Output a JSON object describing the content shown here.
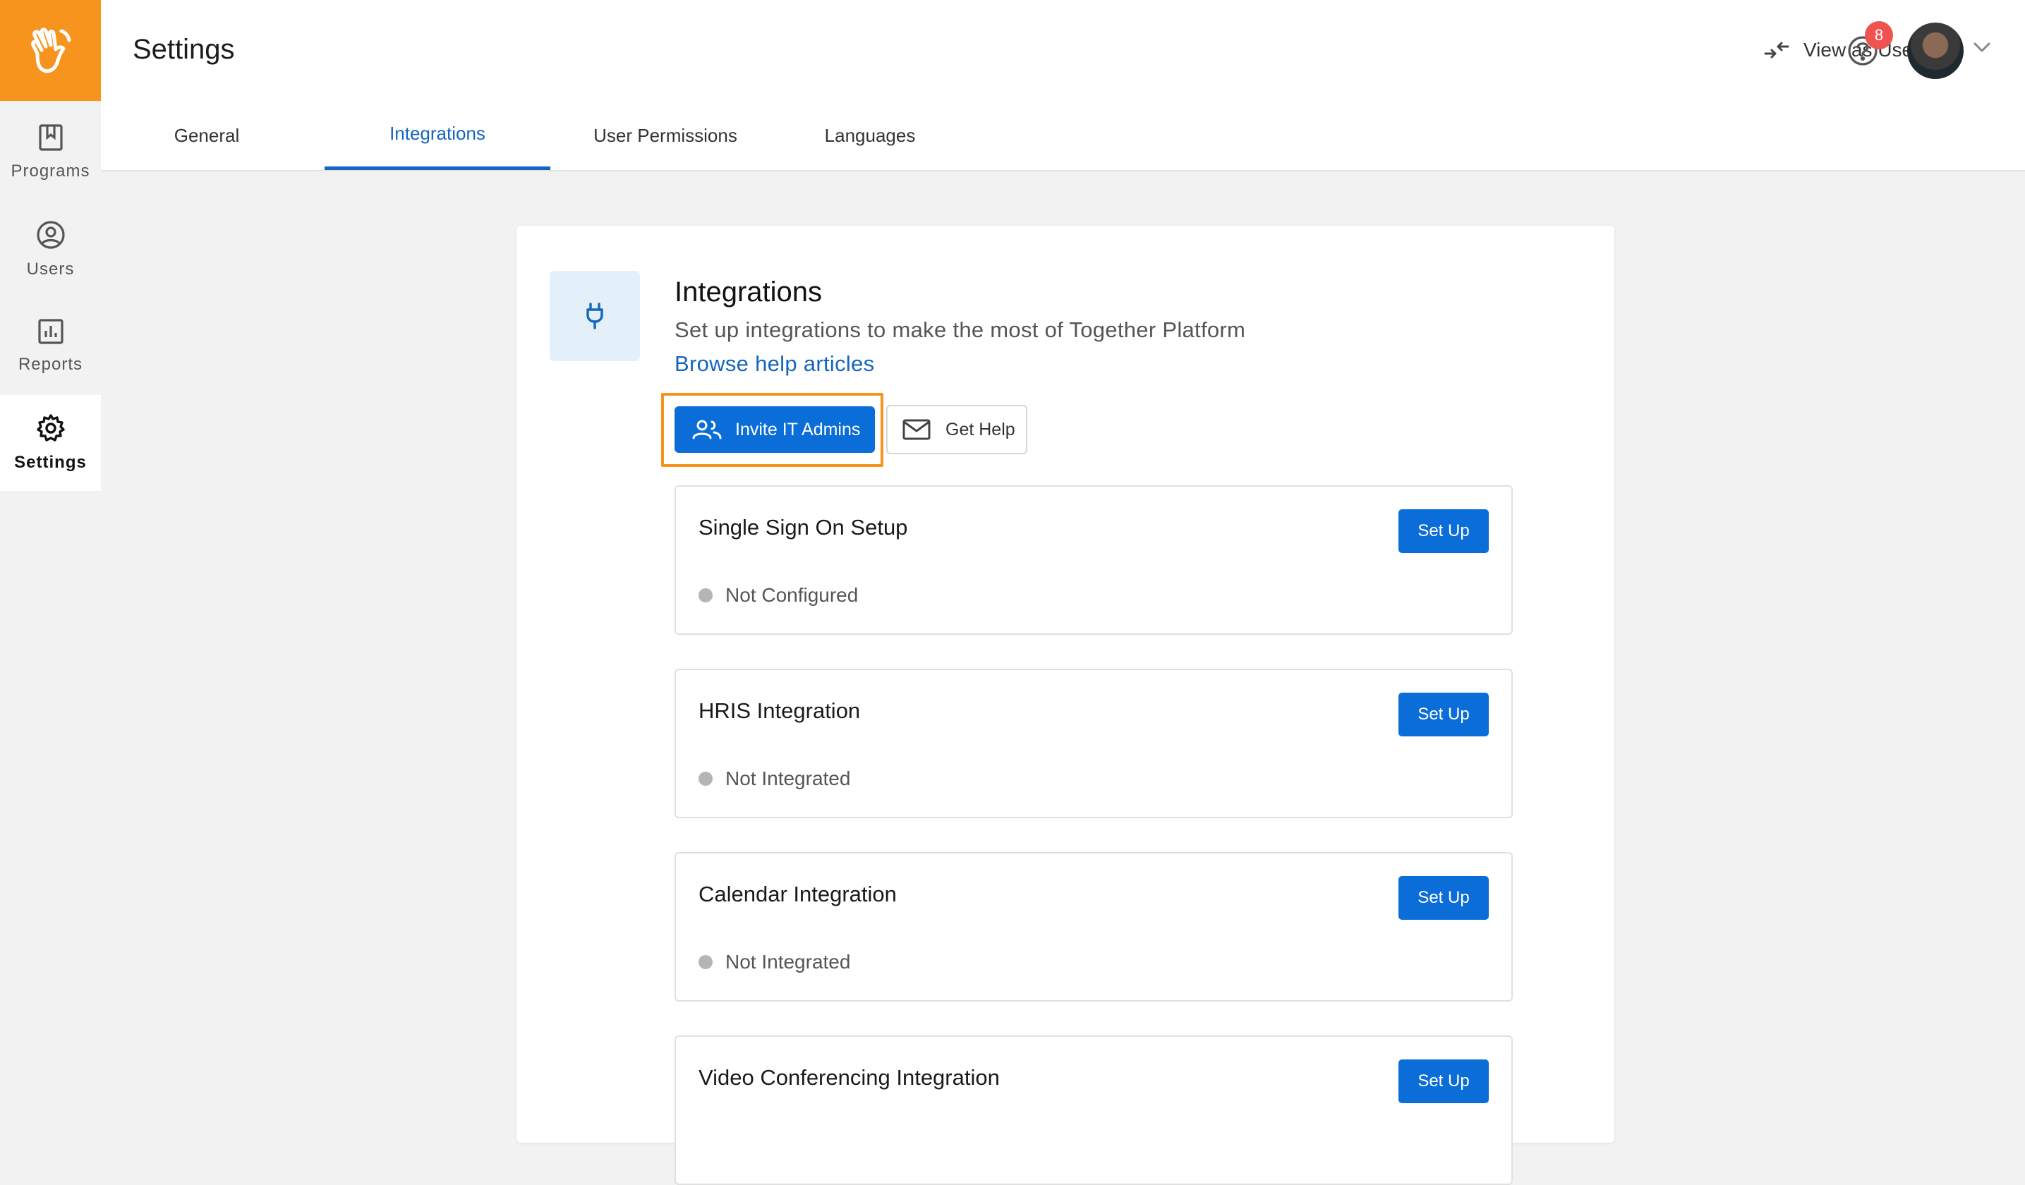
{
  "app": {
    "accent": "#f7941d",
    "primary": "#0a6dd8"
  },
  "sidebar": {
    "items": [
      {
        "label": "Programs",
        "icon": "bookmark-icon"
      },
      {
        "label": "Users",
        "icon": "user-circle-icon"
      },
      {
        "label": "Reports",
        "icon": "bar-chart-icon"
      },
      {
        "label": "Settings",
        "icon": "gear-icon",
        "active": true
      }
    ]
  },
  "header": {
    "title": "Settings",
    "view_as_user": "View as User",
    "notification_count": "8"
  },
  "tabs": [
    {
      "label": "General"
    },
    {
      "label": "Integrations",
      "active": true
    },
    {
      "label": "User Permissions"
    },
    {
      "label": "Languages"
    }
  ],
  "integrations": {
    "title": "Integrations",
    "subtitle": "Set up integrations to make the most of Together Platform",
    "help_link": "Browse help articles",
    "invite_button": "Invite IT Admins",
    "get_help_button": "Get Help",
    "items": [
      {
        "name": "Single Sign On Setup",
        "status": "Not Configured",
        "action": "Set Up"
      },
      {
        "name": "HRIS Integration",
        "status": "Not Integrated",
        "action": "Set Up"
      },
      {
        "name": "Calendar Integration",
        "status": "Not Integrated",
        "action": "Set Up"
      },
      {
        "name": "Video Conferencing Integration",
        "status": "",
        "action": "Set Up"
      }
    ]
  }
}
